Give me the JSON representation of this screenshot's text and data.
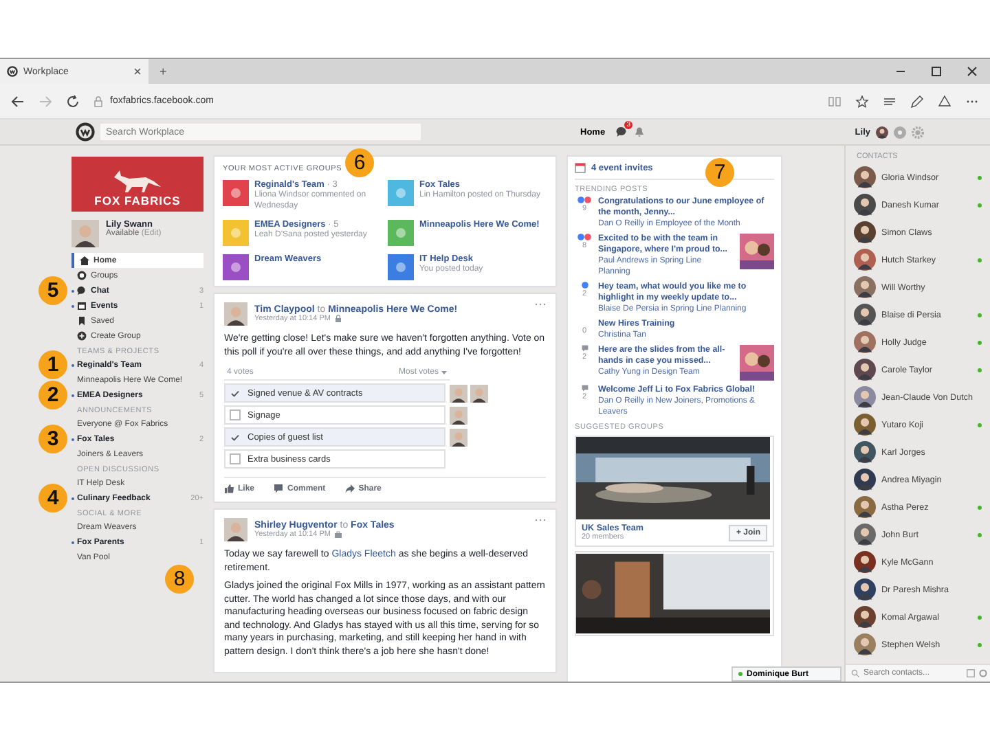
{
  "browser": {
    "tab_title": "Workplace",
    "new_tab": "+",
    "address": "foxfabrics.facebook.com"
  },
  "topbar": {
    "search_placeholder": "Search Workplace",
    "home": "Home",
    "chat_badge": "3",
    "user": "Lily"
  },
  "sidebar": {
    "brand": "FOX FABRICS",
    "profile": {
      "name": "Lily Swann",
      "status": "Available",
      "edit": "(Edit)"
    },
    "sections": [
      {
        "items": [
          {
            "label": "Home",
            "selected": true,
            "unread": false
          },
          {
            "label": "Groups",
            "selected": false,
            "unread": false
          },
          {
            "label": "Chat",
            "selected": false,
            "unread": true,
            "count": "3",
            "callout": "5"
          },
          {
            "label": "Events",
            "selected": false,
            "unread": true,
            "count": "1"
          },
          {
            "label": "Saved",
            "selected": false,
            "unread": false
          },
          {
            "label": "Create Group",
            "selected": false,
            "unread": false
          }
        ]
      },
      {
        "title": "TEAMS & PROJECTS",
        "items": [
          {
            "label": "Reginald's Team",
            "selected": false,
            "unread": true,
            "count": "4",
            "callout": "1"
          },
          {
            "label": "Minneapolis Here We Come!",
            "selected": false,
            "unread": false
          },
          {
            "label": "EMEA Designers",
            "selected": false,
            "unread": true,
            "count": "5",
            "callout": "2"
          }
        ]
      },
      {
        "title": "ANNOUNCEMENTS",
        "items": [
          {
            "label": "Everyone @ Fox Fabrics",
            "selected": false,
            "unread": false
          },
          {
            "label": "Fox Tales",
            "selected": false,
            "unread": true,
            "count": "2",
            "callout": "3"
          },
          {
            "label": "Joiners & Leavers",
            "selected": false,
            "unread": false
          }
        ]
      },
      {
        "title": "OPEN DISCUSSIONS",
        "items": [
          {
            "label": "IT Help Desk",
            "selected": false,
            "unread": false
          },
          {
            "label": "Culinary Feedback",
            "selected": false,
            "unread": true,
            "count": "20+",
            "callout": "4"
          }
        ]
      },
      {
        "title": "SOCIAL & MORE",
        "items": [
          {
            "label": "Dream Weavers",
            "selected": false,
            "unread": false
          },
          {
            "label": "Fox Parents",
            "selected": false,
            "unread": true,
            "count": "1"
          },
          {
            "label": "Van Pool",
            "selected": false,
            "unread": false
          }
        ]
      }
    ]
  },
  "active_groups": {
    "title": "YOUR MOST ACTIVE GROUPS",
    "callout": "6",
    "groups": [
      {
        "name": "Reginald's Team",
        "count": "· 3",
        "activity": "Lliona Windsor commented on Wednesday",
        "color": "#e0434b"
      },
      {
        "name": "Fox Tales",
        "activity": "Lin Hamilton posted on Thursday",
        "color": "#4fb8e0"
      },
      {
        "name": "EMEA Designers",
        "count": "· 5",
        "activity": "Leah D'Sana posted yesterday",
        "color": "#f2c230"
      },
      {
        "name": "Minneapolis Here We Come!",
        "color": "#5cb85c"
      },
      {
        "name": "Dream Weavers",
        "color": "#9b4fc4"
      },
      {
        "name": "IT Help Desk",
        "activity": "You posted today",
        "color": "#3b7de0"
      }
    ]
  },
  "posts": [
    {
      "author": "Tim Claypool",
      "to": "to",
      "group": "Minneapolis Here We Come!",
      "time": "Yesterday at 10:14 PM",
      "paragraphs": [
        [
          {
            "kind": "text",
            "text": "We're getting close! Let's make sure we haven't forgotten anything. Vote on this poll if you're all over these things, and add anything I've forgotten!"
          }
        ]
      ],
      "poll": {
        "votes": "4 votes",
        "sort": "Most votes",
        "options": [
          {
            "label": "Signed venue & AV contracts",
            "checked": true,
            "voters": [
              {
                "kind": "avatar"
              },
              {
                "kind": "avatar"
              }
            ]
          },
          {
            "label": "Signage",
            "checked": false,
            "voters": [
              {
                "kind": "avatar"
              }
            ]
          },
          {
            "label": "Copies of guest list",
            "checked": true,
            "voters": [
              {
                "kind": "avatar"
              }
            ]
          },
          {
            "label": "Extra business cards",
            "checked": false
          }
        ]
      },
      "actions": [
        "Like",
        "Comment",
        "Share"
      ]
    },
    {
      "author": "Shirley Hugventor",
      "to": "to",
      "group": "Fox Tales",
      "time": "Yesterday at 10:14 PM",
      "callout": "8",
      "paragraphs": [
        [
          {
            "kind": "text",
            "text": "Today we say farewell to "
          },
          {
            "kind": "link",
            "text": "Gladys Fleetch"
          },
          {
            "kind": "text",
            "text": " as she begins a well-deserved retirement."
          }
        ],
        [
          {
            "kind": "text",
            "text": "Gladys joined the original Fox Mills in 1977, working as an assistant pattern cutter. The world has changed a lot since those days, and with our manufacturing heading overseas our business focused on fabric design and technology. And Gladys has stayed with us all this time, serving for so many years in purchasing, marketing, and still keeping her hand in with pattern design. I don't think there's a job here she hasn't done!"
          }
        ]
      ]
    }
  ],
  "right": {
    "event_invites": "4 event invites",
    "trending_title": "TRENDING POSTS",
    "callout": "7",
    "trending": [
      {
        "reactions": [
          {
            "kind": "like"
          },
          {
            "kind": "love"
          }
        ],
        "count": "9",
        "title": "Congratulations to our June employee of the month, Jenny...",
        "meta": "Dan O Reilly in Employee of the Month"
      },
      {
        "reactions": [
          {
            "kind": "like"
          },
          {
            "kind": "love"
          }
        ],
        "count": "8",
        "title": "Excited to be with the team in Singapore, where I'm proud to...",
        "meta": "Paul Andrews in Spring Line Planning",
        "thumbnail": {
          "kind": "picture"
        }
      },
      {
        "reactions": [
          {
            "kind": "like"
          }
        ],
        "count": "2",
        "title": "Hey team, what would you like me to highlight in my weekly update to...",
        "meta": "Blaise De Persia in Spring Line Planning"
      },
      {
        "count": "0",
        "title": "New Hires Training",
        "meta": "Christina Tan"
      },
      {
        "reactions": [
          {
            "kind": "comment"
          }
        ],
        "count": "2",
        "title": "Here are the slides from the all-hands in case you missed...",
        "meta": "Cathy Yung in Design Team",
        "thumbnail": {
          "kind": "picture"
        }
      },
      {
        "reactions": [
          {
            "kind": "comment"
          }
        ],
        "count": "2",
        "title": "Welcome Jeff Li to Fox Fabrics Global!",
        "meta": "Dan O Reilly in New Joiners, Promotions & Leavers"
      }
    ],
    "suggested_title": "SUGGESTED GROUPS",
    "suggested": [
      {
        "kind": "group",
        "name": "UK Sales Team",
        "members": "20 members",
        "join": "+ Join"
      },
      {
        "kind": "picture"
      }
    ]
  },
  "chat_tab": {
    "name": "Dominique Burt",
    "online": true
  },
  "contacts": {
    "title": "CONTACTS",
    "search_placeholder": "Search contacts...",
    "people": [
      {
        "name": "Gloria Windsor",
        "online": true
      },
      {
        "name": "Danesh Kumar",
        "online": true
      },
      {
        "name": "Simon Claws",
        "online": false
      },
      {
        "name": "Hutch Starkey",
        "online": true
      },
      {
        "name": "Will Worthy",
        "online": false
      },
      {
        "name": "Blaise di Persia",
        "online": true
      },
      {
        "name": "Holly Judge",
        "online": true
      },
      {
        "name": "Carole Taylor",
        "online": true
      },
      {
        "name": "Jean-Claude Von Dutch",
        "online": false
      },
      {
        "name": "Yutaro Koji",
        "online": true
      },
      {
        "name": "Karl Jorges",
        "online": false
      },
      {
        "name": "Andrea Miyagin",
        "online": false
      },
      {
        "name": "Astha Perez",
        "online": true
      },
      {
        "name": "John Burt",
        "online": true
      },
      {
        "name": "Kyle McGann",
        "online": false
      },
      {
        "name": "Dr Paresh Mishra",
        "online": false
      },
      {
        "name": "Komal Argawal",
        "online": true
      },
      {
        "name": "Stephen Welsh",
        "online": true
      }
    ]
  }
}
